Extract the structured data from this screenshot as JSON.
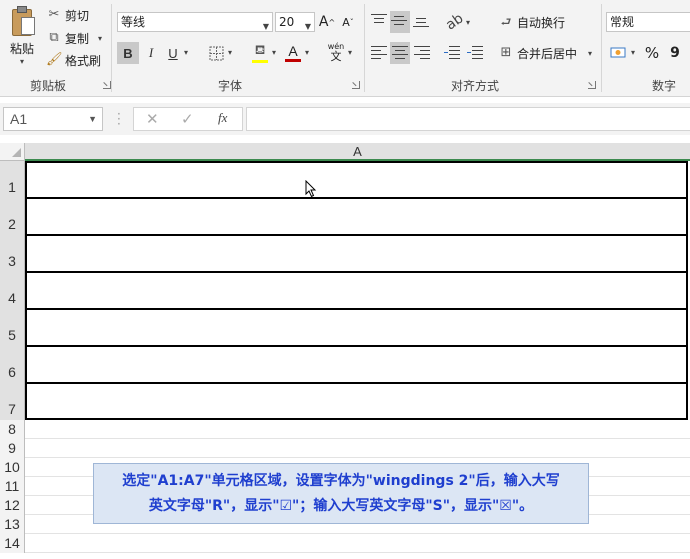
{
  "ribbon": {
    "clipboard": {
      "paste_label": "粘贴",
      "cut_label": "剪切",
      "copy_label": "复制",
      "format_painter_label": "格式刷",
      "group_label": "剪贴板"
    },
    "font": {
      "font_name": "等线",
      "font_size": "20",
      "group_label": "字体",
      "bold_label": "B",
      "italic_label": "I",
      "underline_label": "U",
      "grow_label": "A",
      "shrink_label": "A",
      "font_color_label": "A",
      "phonetic_label": "wén",
      "phonetic_char": "文"
    },
    "alignment": {
      "wrap_text_label": "自动换行",
      "merge_center_label": "合并后居中",
      "group_label": "对齐方式"
    },
    "number": {
      "format_value": "常规",
      "percent_label": "%",
      "comma_label": "9",
      "group_label": "数字"
    }
  },
  "formula_bar": {
    "name_box": "A1",
    "fx_label": "fx",
    "formula_value": ""
  },
  "grid": {
    "column_header": "A",
    "rows": [
      "1",
      "2",
      "3",
      "4",
      "5",
      "6",
      "7",
      "8",
      "9",
      "10",
      "11",
      "12",
      "13",
      "14"
    ]
  },
  "note": {
    "line1": "选定\"A1:A7\"单元格区域，设置字体为\"wingdings 2\"后，输入大写",
    "line2": "英文字母\"R\"，显示\"☑\"；输入大写英文字母\"S\"，显示\"☒\"。"
  },
  "colors": {
    "accent_green": "#3c8a4f",
    "note_text": "#1f3fcf",
    "note_bg": "#dce6f4",
    "font_color_bar": "#c00000"
  }
}
